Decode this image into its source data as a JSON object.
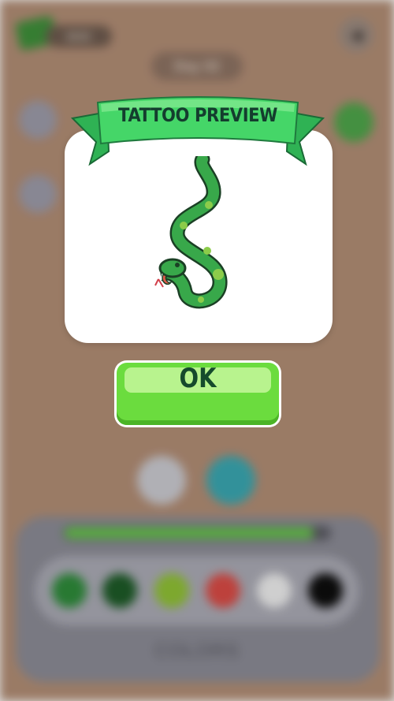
{
  "background": {
    "cash_amount": "8000",
    "day_label": "Day 02",
    "colors_label": "COLORS",
    "palette": [
      "#2e8a3a",
      "#1d5a27",
      "#8fc035",
      "#d84b45",
      "#ececec",
      "#0d0d0d"
    ],
    "progress": 0.93
  },
  "dialog": {
    "title": "TATTOO PREVIEW",
    "ok_label": "OK",
    "tattoo_icon": "snake-tattoo",
    "ribbon_color": "#45d668",
    "button_color": "#6bdc3e"
  }
}
